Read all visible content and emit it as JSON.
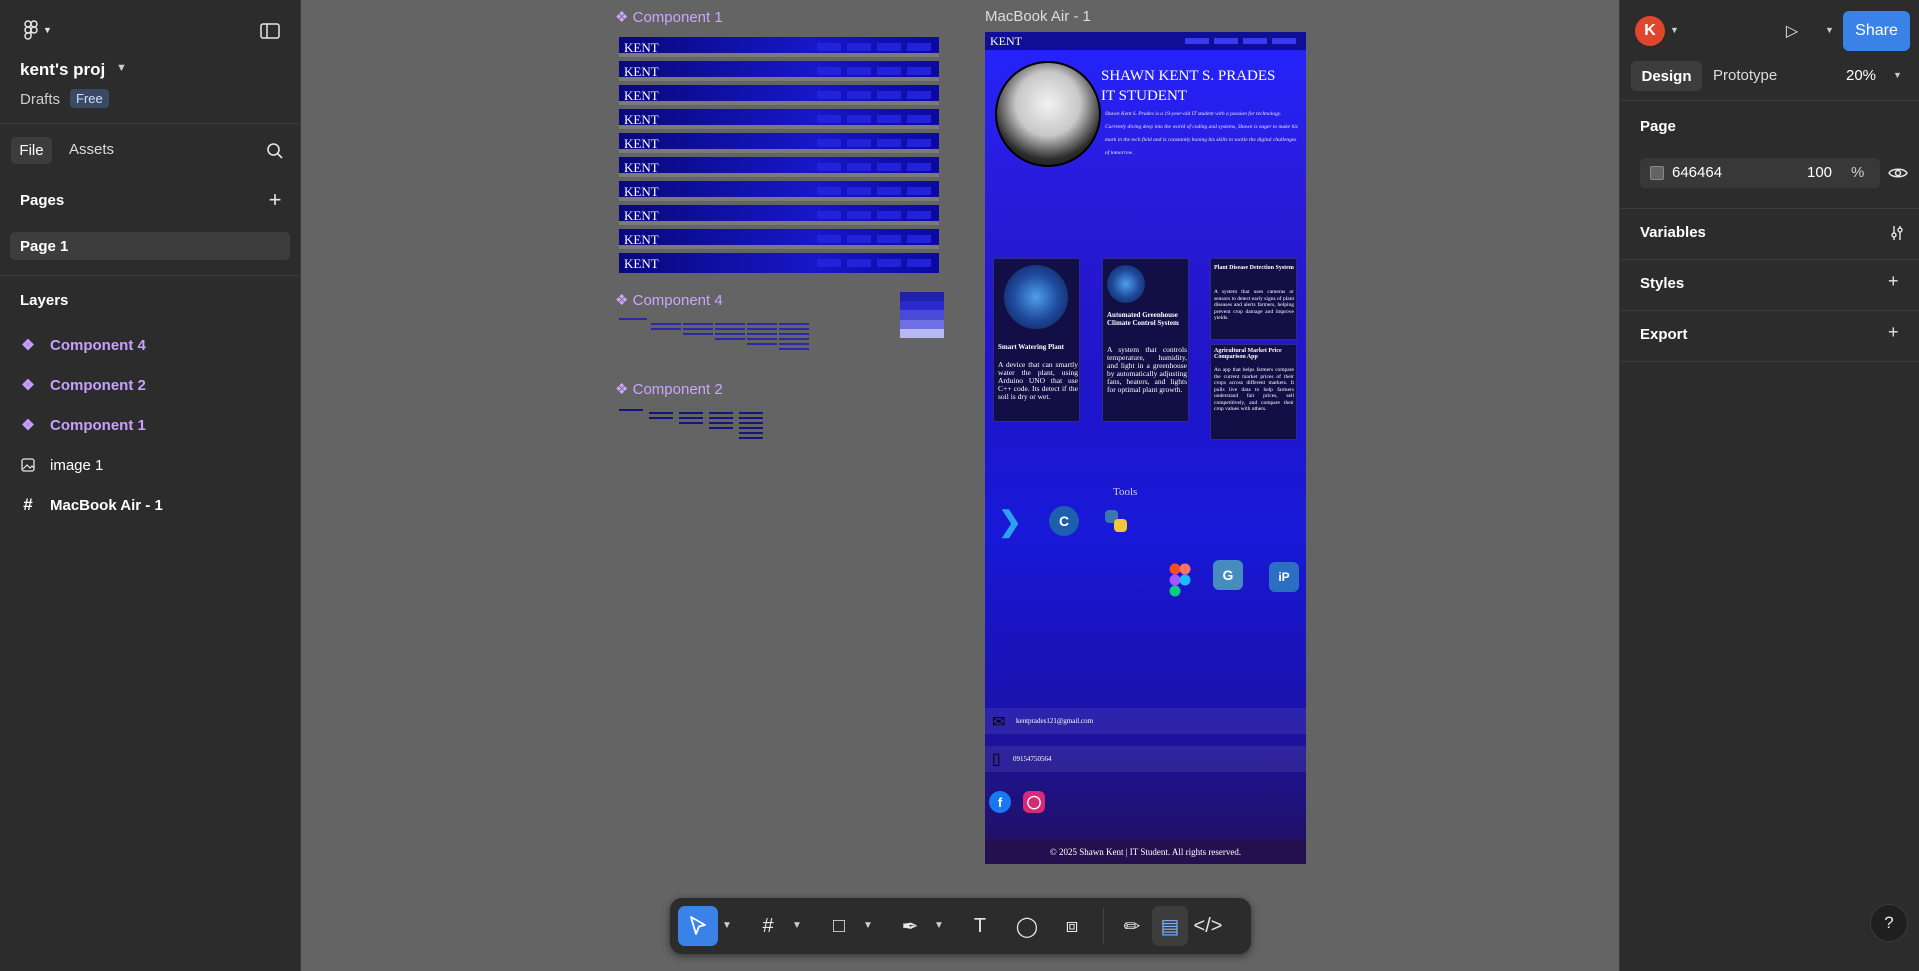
{
  "app": {
    "project_name": "kent's proj",
    "drafts_label": "Drafts",
    "plan_badge": "Free"
  },
  "left_tabs": {
    "file": "File",
    "assets": "Assets"
  },
  "pages": {
    "heading": "Pages",
    "items": [
      "Page 1"
    ]
  },
  "layers": {
    "heading": "Layers",
    "items": [
      {
        "label": "Component 4",
        "kind": "component"
      },
      {
        "label": "Component 2",
        "kind": "component"
      },
      {
        "label": "Component 1",
        "kind": "component"
      },
      {
        "label": "image 1",
        "kind": "image"
      },
      {
        "label": "MacBook Air - 1",
        "kind": "frame"
      }
    ]
  },
  "canvas": {
    "labels": {
      "component1": "Component 1",
      "component4": "Component 4",
      "component2": "Component 2",
      "macbook": "MacBook Air - 1"
    },
    "navbar_brand": "KENT"
  },
  "site": {
    "brand": "KENT",
    "name": "SHAWN KENT S. PRADES",
    "role": "IT STUDENT",
    "bio": "Shawn Kent S. Prades is a 19-year-old IT student with a passion for technology. Currently diving deep into the world of coding and systems, Shawn is eager to make his mark in the tech field and is constantly honing his skills to tackle the digital challenges of tomorrow.",
    "projects": [
      {
        "title": "Smart Watering Plant",
        "body": "A device that can smartly water the plant, using Arduino UNO that use C++ code. Its detect if the soil is dry or wet."
      },
      {
        "title": "Automated Greenhouse Climate Control System",
        "body": "A system that controls temperature, humidity, and light in a greenhouse by automatically adjusting fans, heaters, and lights for optimal plant growth."
      },
      {
        "title": "Plant Disease Detection System",
        "body": "A system that uses cameras or sensors to detect early signs of plant diseases and alerts farmers, helping prevent crop damage and improve yields."
      },
      {
        "title": "Agricultural Market Price Comparison App",
        "body": "An app that helps farmers compare the current market prices of their crops across different markets. It pulls live data to help farmers understand fair prices, sell competitively, and compare their crop values with others."
      }
    ],
    "tools_title": "Tools",
    "email": "kentprades121@gmail.com",
    "phone": "09154750564",
    "footer": "© 2025 Shawn Kent | IT Student. All rights reserved."
  },
  "right": {
    "user_initial": "K",
    "share_label": "Share",
    "tab_design": "Design",
    "tab_prototype": "Prototype",
    "zoom": "20%",
    "page_heading": "Page",
    "page_color_hex": "646464",
    "page_opacity": "100",
    "percent": "%",
    "sections": [
      "Variables",
      "Styles",
      "Export"
    ],
    "help": "?"
  },
  "colors": {
    "canvas_bg": "#646464",
    "accent_blue": "#3b82e8",
    "component_purple": "#c7a0ff",
    "avatar_red": "#e0452d"
  }
}
